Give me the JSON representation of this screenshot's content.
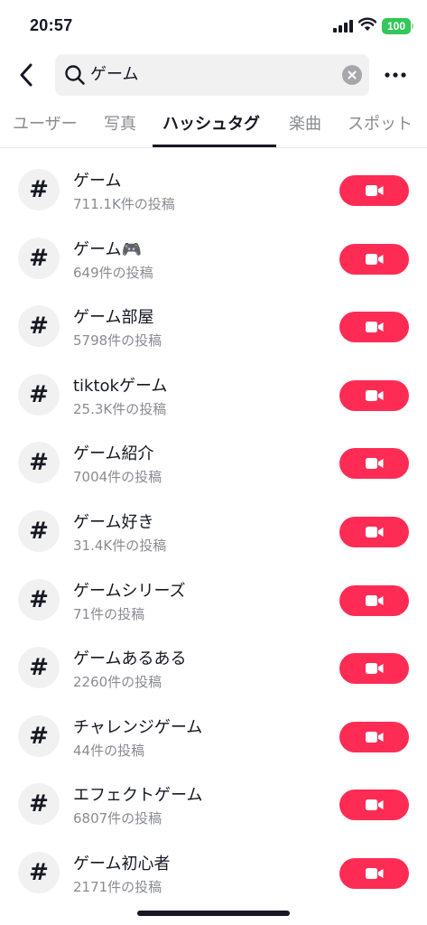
{
  "status_bar": {
    "time": "20:57",
    "battery": "100",
    "icons": [
      "signal-icon",
      "wifi-icon",
      "battery-icon"
    ]
  },
  "header": {
    "back_icon": "chevron-left-icon",
    "search": {
      "icon": "search-icon",
      "value": "ゲーム",
      "clear_icon": "clear-icon"
    },
    "more_icon": "more-horizontal-icon"
  },
  "tabs": [
    {
      "label": "ユーザー",
      "active": false
    },
    {
      "label": "写真",
      "active": false
    },
    {
      "label": "ハッシュタグ",
      "active": true
    },
    {
      "label": "楽曲",
      "active": false
    },
    {
      "label": "スポット",
      "active": false
    }
  ],
  "hashtags": [
    {
      "symbol": "#",
      "name": "ゲーム",
      "count": "711.1K件の投稿"
    },
    {
      "symbol": "#",
      "name": "ゲーム🎮",
      "count": "649件の投稿"
    },
    {
      "symbol": "#",
      "name": "ゲーム部屋",
      "count": "5798件の投稿"
    },
    {
      "symbol": "#",
      "name": "tiktokゲーム",
      "count": "25.3K件の投稿"
    },
    {
      "symbol": "#",
      "name": "ゲーム紹介",
      "count": "7004件の投稿"
    },
    {
      "symbol": "#",
      "name": "ゲーム好き",
      "count": "31.4K件の投稿"
    },
    {
      "symbol": "#",
      "name": "ゲームシリーズ",
      "count": "71件の投稿"
    },
    {
      "symbol": "#",
      "name": "ゲームあるある",
      "count": "2260件の投稿"
    },
    {
      "symbol": "#",
      "name": "チャレンジゲーム",
      "count": "44件の投稿"
    },
    {
      "symbol": "#",
      "name": "エフェクトゲーム",
      "count": "6807件の投稿"
    },
    {
      "symbol": "#",
      "name": "ゲーム初心者",
      "count": "2171件の投稿"
    }
  ],
  "record_button_icon": "video-camera-icon",
  "colors": {
    "accent": "#fe2c55",
    "text": "#161823",
    "secondary_text": "#8a8b91",
    "battery": "#34c759",
    "field_bg": "#f1f1f2"
  }
}
